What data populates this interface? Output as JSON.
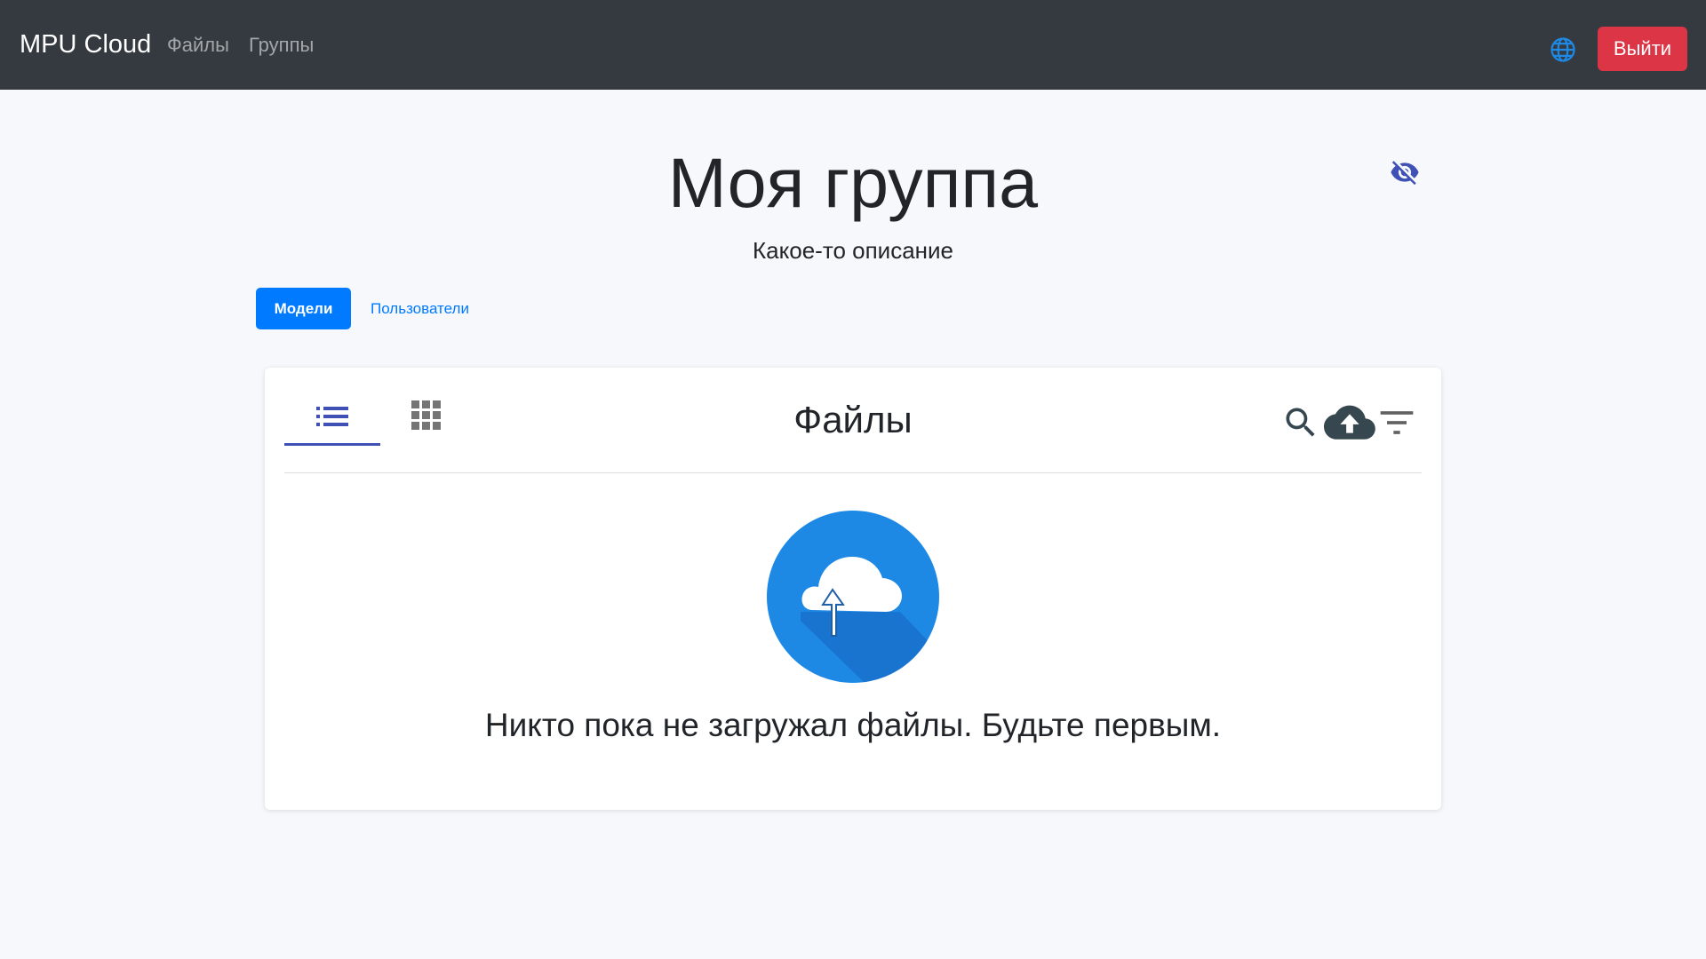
{
  "navbar": {
    "brand": "MPU Cloud",
    "links": [
      "Файлы",
      "Группы"
    ],
    "language_icon": "globe-icon",
    "logout_label": "Выйти"
  },
  "group": {
    "title": "Моя группа",
    "description": "Какое-то описание",
    "visibility_icon": "eye-off-icon"
  },
  "tabs": {
    "active": "Модели",
    "items": [
      "Модели",
      "Пользователи"
    ]
  },
  "files_panel": {
    "title": "Файлы",
    "active_view": "list",
    "views": [
      "list-view-icon",
      "grid-view-icon"
    ],
    "tools": [
      "search-icon",
      "cloud-upload-icon",
      "filter-icon"
    ],
    "empty_illustration": "cloud-upload-illustration",
    "empty_message": "Никто пока не загружал файлы. Будьте первым."
  },
  "colors": {
    "navbar_bg": "#343a40",
    "logout_bg": "#dc3545",
    "primary": "#007bff",
    "accent": "#3f51b5",
    "globe": "#1e88e5",
    "illustration": "#1e88e5",
    "page_bg": "#f7f8fc"
  }
}
